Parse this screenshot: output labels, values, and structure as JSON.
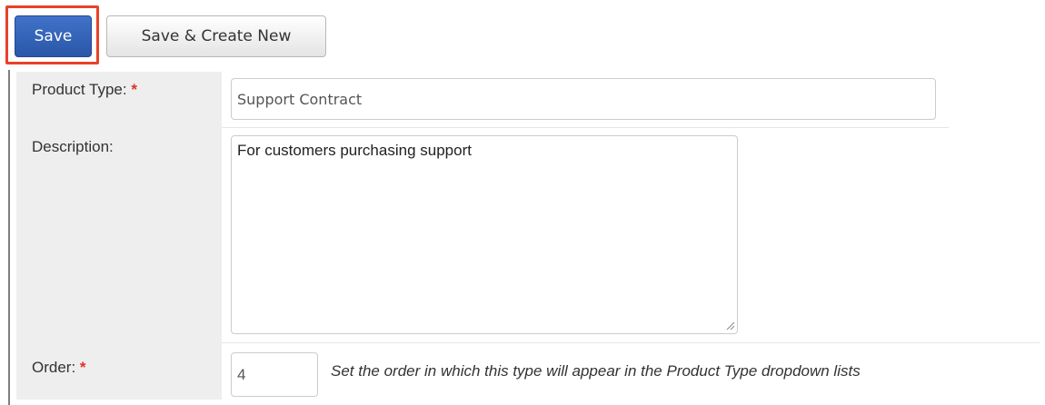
{
  "toolbar": {
    "save_label": "Save",
    "save_create_label": "Save & Create New"
  },
  "form": {
    "product_type": {
      "label": "Product Type:",
      "required_mark": "*",
      "value": "Support Contract"
    },
    "description": {
      "label": "Description:",
      "value": "For customers purchasing support"
    },
    "order": {
      "label": "Order:",
      "required_mark": "*",
      "value": "4",
      "help_text": "Set the order in which this type will appear in the Product Type dropdown lists"
    }
  },
  "colors": {
    "primary_button": "#2f5fb8",
    "highlight": "#e8412a",
    "required": "#e0302a",
    "label_column": "#eeeeee"
  }
}
